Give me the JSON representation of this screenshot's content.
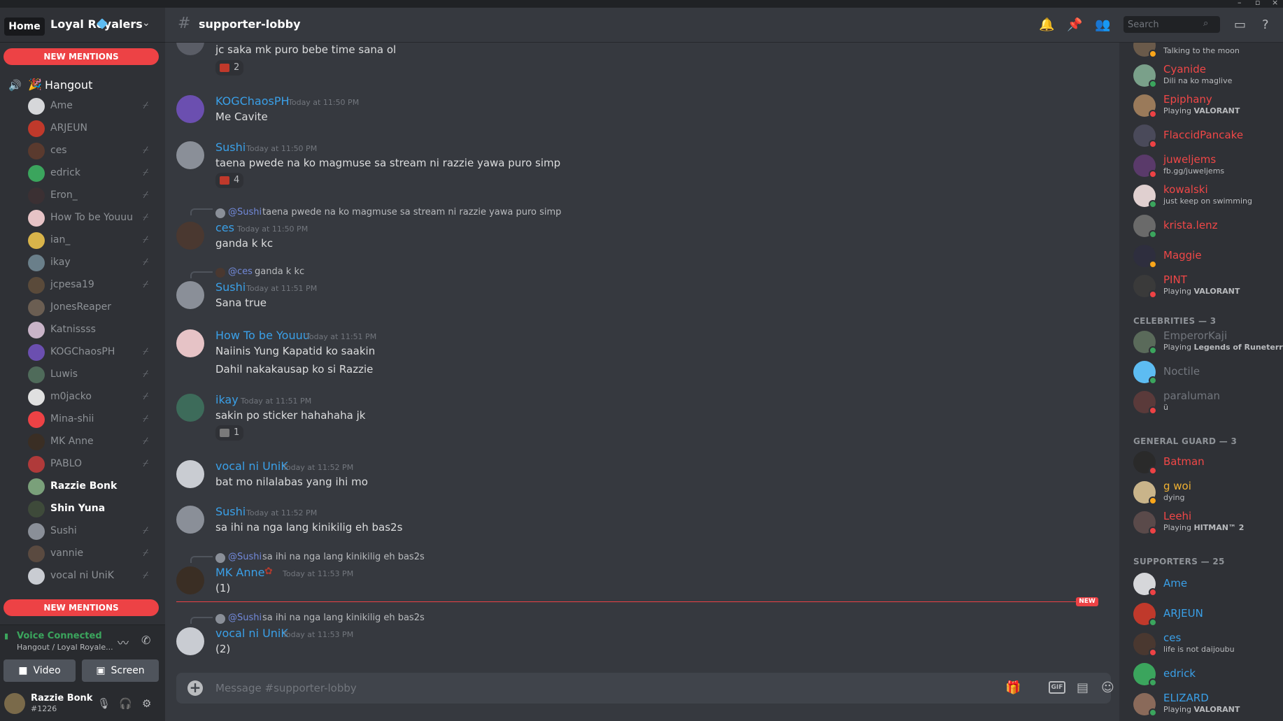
{
  "server": {
    "name": "Loyal Royalers",
    "home_label": "Home"
  },
  "sidebar": {
    "new_mentions_label": "NEW MENTIONS",
    "voice_channel": "Hangout",
    "voice_users": [
      {
        "name": "Ame",
        "deafened": true,
        "live": false
      },
      {
        "name": "ARJEUN",
        "deafened": false,
        "live": false
      },
      {
        "name": "ces",
        "deafened": true,
        "live": false
      },
      {
        "name": "edrick",
        "deafened": true,
        "live": false
      },
      {
        "name": "Eron_",
        "deafened": true,
        "live": false
      },
      {
        "name": "How To be Youuu",
        "deafened": true,
        "live": false
      },
      {
        "name": "ian_",
        "deafened": true,
        "live": false
      },
      {
        "name": "ikay",
        "deafened": true,
        "live": false
      },
      {
        "name": "jcpesa19",
        "deafened": true,
        "live": false
      },
      {
        "name": "JonesReaper",
        "deafened": false,
        "live": false
      },
      {
        "name": "Katnissss",
        "deafened": false,
        "live": false
      },
      {
        "name": "KOGChaosPH",
        "deafened": true,
        "live": false
      },
      {
        "name": "Luwis",
        "deafened": true,
        "live": false
      },
      {
        "name": "m0jacko",
        "deafened": true,
        "live": false
      },
      {
        "name": "Mina-shii",
        "deafened": true,
        "live": false
      },
      {
        "name": "MK Anne",
        "deafened": true,
        "live": false
      },
      {
        "name": "PABLO",
        "deafened": true,
        "live": false
      },
      {
        "name": "Razzie Bonk",
        "deafened": false,
        "live": true
      },
      {
        "name": "Shin Yuna",
        "deafened": false,
        "live": true
      },
      {
        "name": "Sushi",
        "deafened": true,
        "live": false
      },
      {
        "name": "vannie",
        "deafened": true,
        "live": false
      },
      {
        "name": "vocal ni UniK",
        "deafened": true,
        "live": false
      }
    ],
    "voice_panel": {
      "status": "Voice Connected",
      "location": "Hangout / Loyal Royale...",
      "video_label": "Video",
      "screen_label": "Screen"
    },
    "user": {
      "name": "Razzie Bonk",
      "tag": "#1226"
    }
  },
  "channel": {
    "name": "supporter-lobby",
    "search_placeholder": "Search",
    "composer_placeholder": "Message #supporter-lobby",
    "gif_label": "GIF",
    "new_label": "NEW"
  },
  "messages": [
    {
      "author": "",
      "time": "",
      "text": "jc saka mk puro bebe time sana ol",
      "reaction_count": "2"
    },
    {
      "author": "KOGChaosPH",
      "time": "Today at 11:50 PM",
      "text": "Me Cavite"
    },
    {
      "author": "Sushi",
      "time": "Today at 11:50 PM",
      "text": "taena pwede na ko magmuse sa stream ni razzie yawa puro simp",
      "reaction_count": "4"
    },
    {
      "reply_to": "@Sushi",
      "reply_text": "taena pwede na ko magmuse sa stream ni razzie yawa puro simp",
      "author": "ces",
      "time": "Today at 11:50 PM",
      "text": "ganda k kc"
    },
    {
      "reply_to": "@ces",
      "reply_text": "ganda k kc",
      "author": "Sushi",
      "time": "Today at 11:51 PM",
      "text": "Sana true"
    },
    {
      "author": "How To be Youuu",
      "time": "Today at 11:51 PM",
      "text": "Naiinis Yung Kapatid ko saakin",
      "text2": "Dahil nakakausap ko si Razzie"
    },
    {
      "author": "ikay",
      "time": "Today at 11:51 PM",
      "text": "sakin po sticker hahahaha jk",
      "reaction_count": "1"
    },
    {
      "author": "vocal ni UniK",
      "time": "Today at 11:52 PM",
      "text": "bat mo nilalabas yang ihi mo"
    },
    {
      "author": "Sushi",
      "time": "Today at 11:52 PM",
      "text": "sa ihi na nga lang kinikilig eh bas2s"
    },
    {
      "reply_to": "@Sushi",
      "reply_text": "sa ihi na nga lang kinikilig eh bas2s",
      "author": "MK Anne",
      "time": "Today at 11:53 PM",
      "text": "(1)"
    },
    {
      "reply_to": "@Sushi",
      "reply_text": "sa ihi na nga lang kinikilig eh bas2s",
      "author": "vocal ni UniK",
      "time": "Today at 11:53 PM",
      "text": "(2)"
    }
  ],
  "members": {
    "top": [
      {
        "name": "",
        "activity": "Talking to the moon"
      },
      {
        "name": "Cyanide",
        "activity": "Dili na ko maglive"
      },
      {
        "name": "Epiphany",
        "activity": "Playing",
        "game": "VALORANT"
      },
      {
        "name": "FlaccidPancake",
        "activity": ""
      },
      {
        "name": "juweljems",
        "activity": "fb.gg/juweljems"
      },
      {
        "name": "kowalski",
        "activity": "just keep on swimming"
      },
      {
        "name": "krista.lenz",
        "activity": ""
      },
      {
        "name": "Maggie",
        "activity": ""
      },
      {
        "name": "PINT",
        "activity": "Playing",
        "game": "VALORANT"
      }
    ],
    "celebrities_header": "CELEBRITIES — 3",
    "celebrities": [
      {
        "name": "EmperorKaji",
        "activity": "Playing",
        "game": "Legends of Runeterra"
      },
      {
        "name": "Noctile",
        "activity": ""
      },
      {
        "name": "paraluman",
        "activity": "ü"
      }
    ],
    "guard_header": "GENERAL GUARD — 3",
    "guards": [
      {
        "name": "Batman",
        "activity": ""
      },
      {
        "name": "g woi",
        "activity": "dying"
      },
      {
        "name": "Leehi",
        "activity": "Playing",
        "game": "HITMAN™ 2"
      }
    ],
    "supporters_header": "SUPPORTERS — 25",
    "supporters": [
      {
        "name": "Ame",
        "activity": ""
      },
      {
        "name": "ARJEUN",
        "activity": ""
      },
      {
        "name": "ces",
        "activity": "life is not daijoubu"
      },
      {
        "name": "edrick",
        "activity": ""
      },
      {
        "name": "ELIZARD",
        "activity": "Playing",
        "game": "VALORANT"
      }
    ]
  },
  "colors": {
    "blurple": "#5865f2",
    "red_role": "#f04747",
    "blue_name": "#3aa0e8",
    "online": "#3ba55d",
    "dnd": "#ed4245",
    "idle": "#faa61a"
  }
}
